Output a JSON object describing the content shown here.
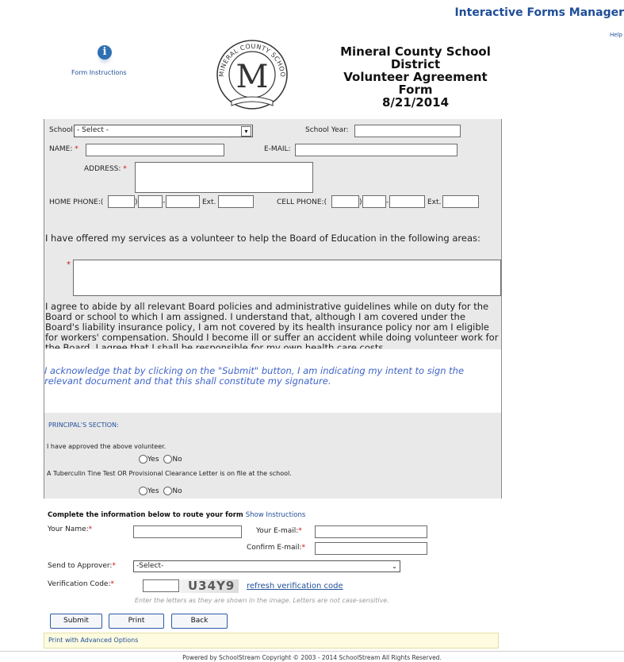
{
  "header": {
    "app_title": "Interactive Forms Manager",
    "help_label": "Help",
    "instructions_label": "Form Instructions",
    "logo_text": "MINERAL COUNTY SCHOOLS",
    "logo_letter": "M",
    "title_lines": [
      "Mineral County School",
      "District",
      "Volunteer Agreement",
      "Form"
    ],
    "date": "8/21/2014"
  },
  "form": {
    "school_label": "School:",
    "school_value": "- Select -",
    "school_year_label": "School Year:",
    "name_label": "NAME:",
    "email_label": "E-MAIL:",
    "address_label": "ADDRESS:",
    "home_phone_label": "HOME PHONE:",
    "cell_phone_label": "CELL PHONE:",
    "ext_label": "Ext.",
    "paren_open": "(",
    "paren_close": ")",
    "dash": "-",
    "required_mark": "*",
    "services_text": "I have offered my services as a volunteer to help the Board of Education in the following areas:",
    "agree_text": "I agree to abide by all relevant Board policies and administrative guidelines while on duty for the Board or school to which I am assigned.  I understand that, although I am covered under the Board's liability insurance policy, I am not covered by its health insurance policy nor am I eligible for workers' compensation.  Should I become ill or suffer an accident while doing volunteer work for the Board, I agree that I shall be responsible for my own health care costs.",
    "acknowledge_text": "I acknowledge that by clicking on the \"Submit\" button, I am indicating my intent to sign the relevant document and that this shall constitute my signature."
  },
  "principal": {
    "heading": "PRINCIPAL'S SECTION:",
    "approved_text": "I have approved the above volunteer.",
    "tb_text": "A Tuberculin Tine Test OR Provisional Clearance Letter is on file at the school.",
    "yes_label": "Yes",
    "no_label": "No"
  },
  "routing": {
    "heading": "Complete the information below to route your form",
    "show_instructions": "Show Instructions",
    "your_name_label": "Your Name:",
    "your_email_label": "Your E-mail:",
    "confirm_email_label": "Confirm E-mail:",
    "send_to_label": "Send to Approver:",
    "send_to_value": "-Select-",
    "verification_label": "Verification Code:",
    "captcha_text": "U34Y9",
    "refresh_link": "refresh verification code",
    "hint": "Enter the letters as they are shown in the image. Letters are not case-sensitive.",
    "submit_label": "Submit",
    "print_label": "Print",
    "back_label": "Back",
    "advanced_print": "Print with Advanced Options"
  },
  "footer": {
    "text": "Powered by SchoolStream Copyright © 2003 - 2014 SchoolStream All Rights Reserved."
  }
}
